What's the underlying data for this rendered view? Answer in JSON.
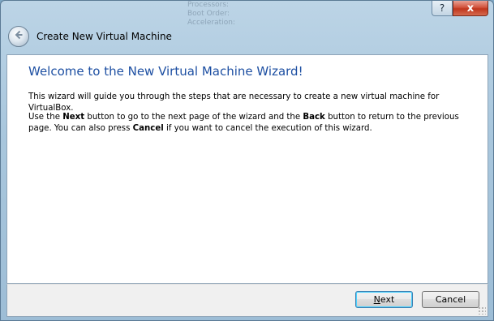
{
  "window": {
    "title": "Create New Virtual Machine",
    "help_label": "?",
    "close_label": "x"
  },
  "ghost_text": [
    "Processors:",
    "Boot Order:",
    "Acceleration:"
  ],
  "content": {
    "heading": "Welcome to the New Virtual Machine Wizard!",
    "paragraph1": "This wizard will guide you through the steps that are necessary to create a new virtual machine for VirtualBox.",
    "paragraph2": {
      "part1": "Use the ",
      "next_word": "Next",
      "part2": " button to go to the next page of the wizard and the ",
      "back_word": "Back",
      "part3": " button to return to the previous page. You can also press ",
      "cancel_word": "Cancel",
      "part4": " if you want to cancel the execution of this wizard."
    }
  },
  "footer": {
    "next_label_mnemonic": "N",
    "next_label_rest": "ext",
    "cancel_label": "Cancel"
  }
}
